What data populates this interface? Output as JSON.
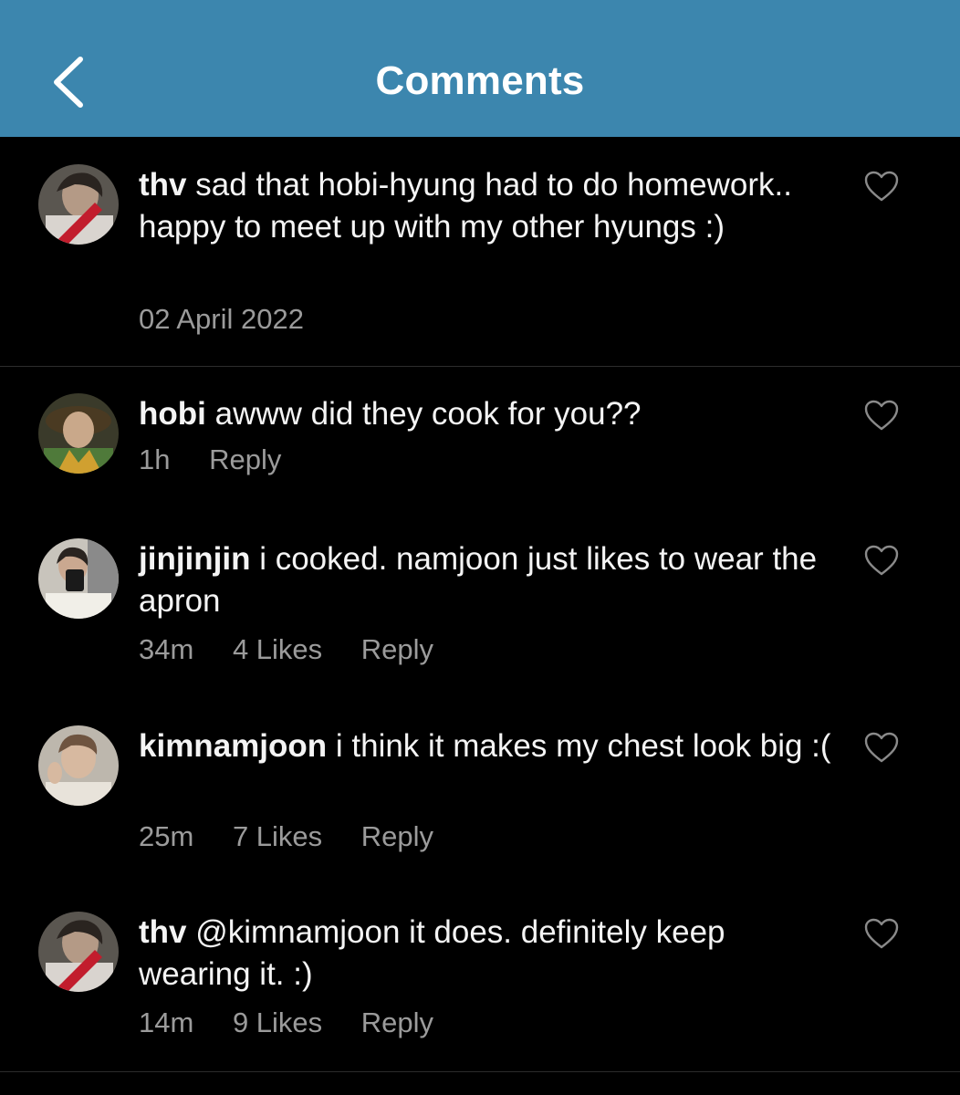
{
  "header": {
    "title": "Comments",
    "back_icon": "chevron-left-icon",
    "color": "#3c86ae"
  },
  "comments": [
    {
      "username": "thv",
      "text": "sad that hobi-hyung had to do homework.. happy to meet up with my other hyungs :)",
      "time": "02 April 2022",
      "avatar_icon": "user-avatar"
    },
    {
      "username": "hobi",
      "text": "awww did they cook for you??",
      "time": "1h",
      "reply": "Reply",
      "avatar_icon": "user-avatar"
    },
    {
      "username": "jinjinjin",
      "text": "i cooked. namjoon just likes to wear the apron",
      "time": "34m",
      "likes": "4 Likes",
      "reply": "Reply",
      "avatar_icon": "user-avatar"
    },
    {
      "username": "kimnamjoon",
      "text": "i think it makes my chest look big :(",
      "time": "25m",
      "likes": "7 Likes",
      "reply": "Reply",
      "avatar_icon": "user-avatar"
    },
    {
      "username": "thv",
      "text": "@kimnamjoon it does. definitely keep wearing it. :)",
      "time": "14m",
      "likes": "9 Likes",
      "reply": "Reply",
      "avatar_icon": "user-avatar"
    }
  ]
}
